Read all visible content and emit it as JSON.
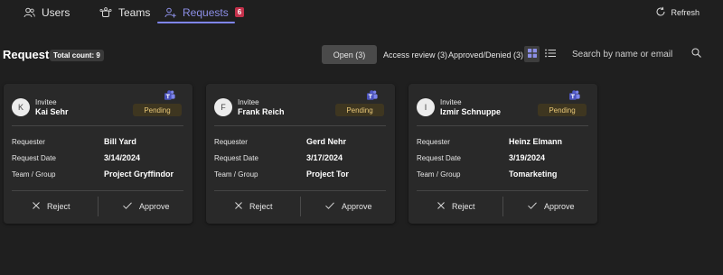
{
  "nav": {
    "tabs": [
      {
        "label": "Users",
        "icon": "users-icon"
      },
      {
        "label": "Teams",
        "icon": "teams-group-icon"
      },
      {
        "label": "Requests",
        "icon": "person-add-icon",
        "badge": "6",
        "active": true
      }
    ],
    "refresh_label": "Refresh"
  },
  "header": {
    "title": "Requests",
    "total_count": "Total count: 9",
    "filters": [
      "Open (3)",
      "Access review (3)",
      "Approved/Denied (3)"
    ],
    "selected_filter": "Open (3)",
    "selected_view": "grid",
    "search_placeholder": "Search by name or email"
  },
  "labels": {
    "invitee": "Invitee",
    "requester": "Requester",
    "request_date": "Request Date",
    "team_group": "Team / Group",
    "reject": "Reject",
    "approve": "Approve"
  },
  "cards": [
    {
      "initial": "K",
      "invitee": "Kai Sehr",
      "status": "Pending",
      "requester": "Bill Yard",
      "request_date": "3/14/2024",
      "team": "Project Gryffindor"
    },
    {
      "initial": "F",
      "invitee": "Frank Reich",
      "status": "Pending",
      "requester": "Gerd Nehr",
      "request_date": "3/17/2024",
      "team": "Project Tor"
    },
    {
      "initial": "I",
      "invitee": "Izmir Schnuppe",
      "status": "Pending",
      "requester": "Heinz Elmann",
      "request_date": "3/19/2024",
      "team": "Tomarketing"
    }
  ],
  "colors": {
    "background": "#1f1f1f",
    "card": "#292929",
    "accent": "#7f85f5",
    "badge": "#c4314b",
    "pending_text": "#e8c776",
    "pending_bg": "#3e3620"
  }
}
